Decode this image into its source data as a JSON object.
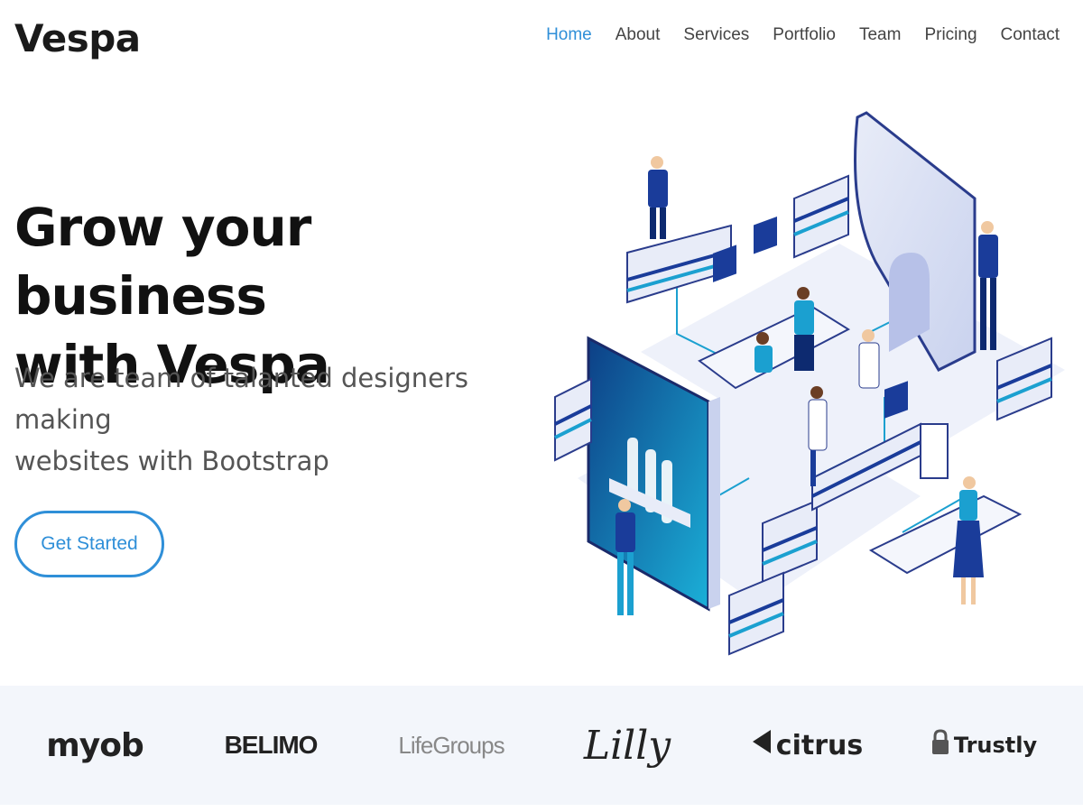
{
  "header": {
    "logo": "Vespa",
    "nav": [
      "Home",
      "About",
      "Services",
      "Portfolio",
      "Team",
      "Pricing",
      "Contact"
    ],
    "active": "Home"
  },
  "hero": {
    "title_line1": "Grow your business",
    "title_line2": "with Vespa",
    "subtitle_line1": "We are team of talanted designers making",
    "subtitle_line2": "websites with Bootstrap",
    "cta_label": "Get Started"
  },
  "clients": [
    "myob",
    "BELIMO",
    "LifeGroups",
    "Lilly",
    "citrus",
    "Trustly"
  ],
  "colors": {
    "accent": "#2f8fd8",
    "strip": "#f3f6fb"
  }
}
